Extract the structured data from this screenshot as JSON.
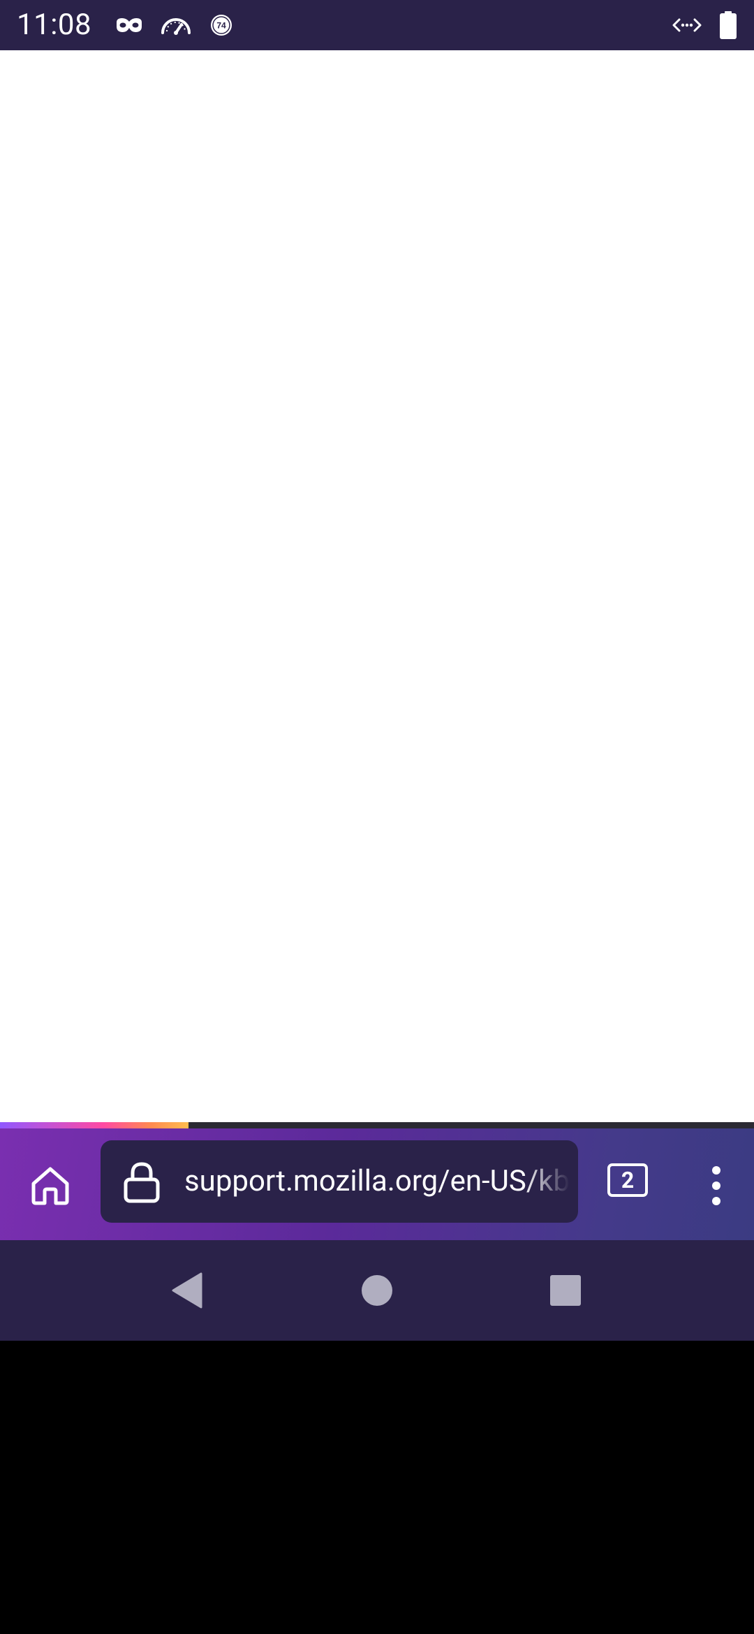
{
  "status_bar": {
    "time": "11:08",
    "icons": [
      "incognito-mask-icon",
      "speedometer-icon",
      "badge-74-icon",
      "data-transfer-icon",
      "battery-icon"
    ],
    "badge_number": "74"
  },
  "browser": {
    "url": "support.mozilla.org/en-US/kb/",
    "tab_count": "2",
    "page_load_progress": 0.25,
    "toolbar_icons": [
      "home-icon",
      "lock-icon",
      "tab-counter",
      "overflow-menu-icon"
    ]
  },
  "navigation": {
    "buttons": [
      "back-triangle-icon",
      "home-circle-icon",
      "recents-square-icon"
    ]
  },
  "colors": {
    "status_bar": "#2a2249",
    "toolbar_gradient_start": "#7a2fb0",
    "toolbar_gradient_end": "#3b3b82",
    "url_bar": "#2a2249",
    "progress_gradient": [
      "#9059ff",
      "#ff4aa2",
      "#ffbd4f"
    ],
    "nav_icon": "#b0aec0"
  }
}
